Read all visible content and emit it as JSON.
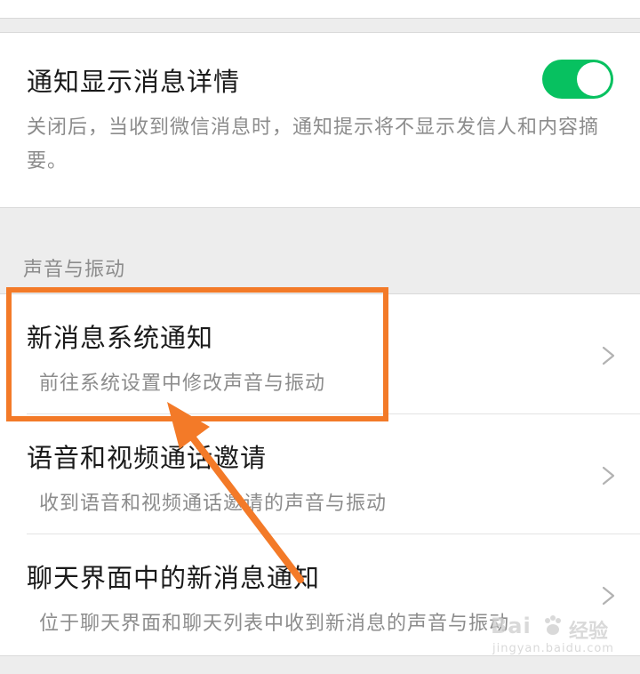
{
  "detail_card": {
    "title": "通知显示消息详情",
    "description": "关闭后，当收到微信消息时，通知提示将不显示发信人和内容摘要。",
    "toggle_on": true
  },
  "section": {
    "header": "声音与振动"
  },
  "rows": [
    {
      "title": "新消息系统通知",
      "subtitle": "前往系统设置中修改声音与振动",
      "icon": "chevron-right-icon"
    },
    {
      "title": "语音和视频通话邀请",
      "subtitle": "收到语音和视频通话邀请的声音与振动",
      "icon": "chevron-right-icon"
    },
    {
      "title": "聊天界面中的新消息通知",
      "subtitle": "位于聊天界面和聊天列表中收到新消息的声音与振动",
      "icon": "chevron-right-icon"
    }
  ],
  "watermark": {
    "logo": "Bai",
    "text": "经验",
    "url": "jingyan.baidu.com"
  },
  "colors": {
    "toggle_on": "#07c160",
    "highlight": "#f37a28",
    "background": "#ededed"
  }
}
